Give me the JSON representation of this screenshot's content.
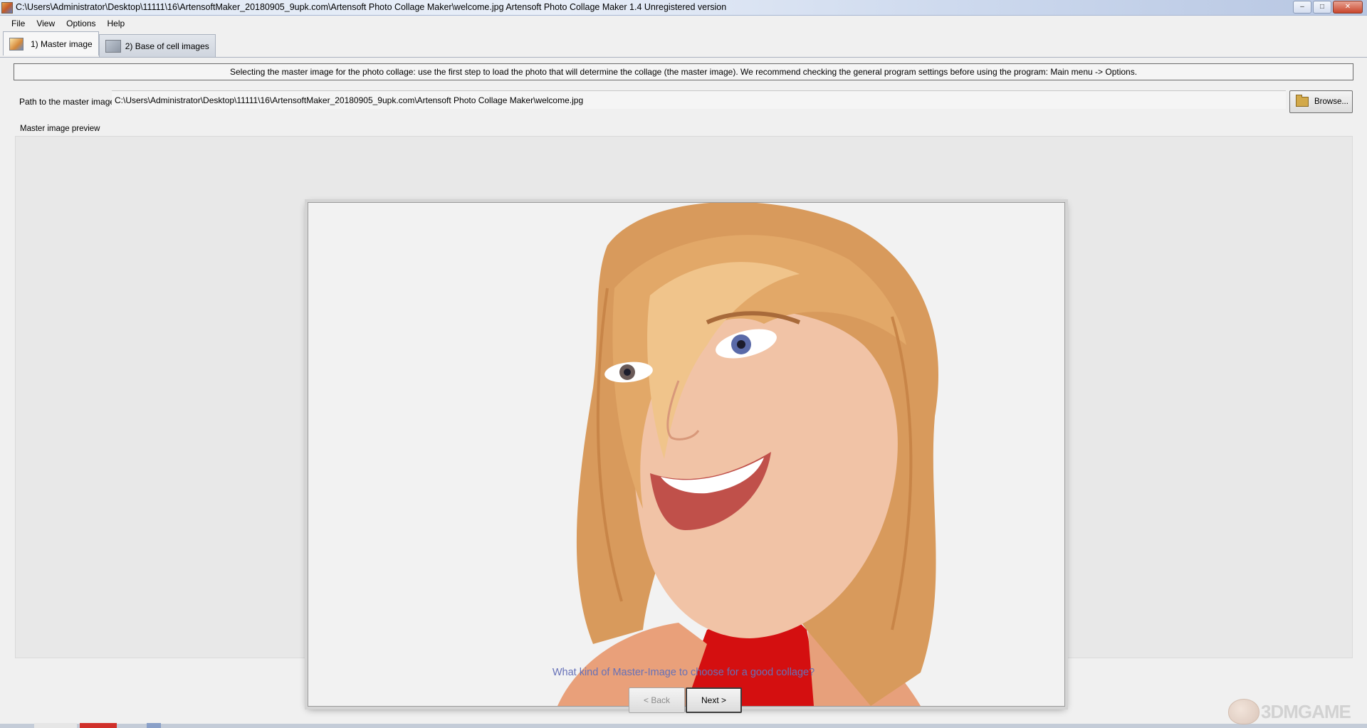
{
  "window": {
    "title": "C:\\Users\\Administrator\\Desktop\\11111\\16\\ArtensoftMaker_20180905_9upk.com\\Artensoft Photo Collage Maker\\welcome.jpg Artensoft Photo Collage Maker 1.4  Unregistered version",
    "controls": {
      "minimize": "–",
      "maximize": "□",
      "close": "✕"
    }
  },
  "menu": {
    "items": [
      "File",
      "View",
      "Options",
      "Help"
    ]
  },
  "tabs": [
    {
      "label": "1) Master image",
      "icon": "master-image-icon"
    },
    {
      "label": "2) Base of cell images",
      "icon": "cell-images-icon"
    }
  ],
  "info": "Selecting the master image for the photo collage: use the first step to load the photo that will determine the collage (the master image). We recommend checking the general program settings before using the program: Main menu -> Options.",
  "path": {
    "label": "Path to the master image:",
    "value": "C:\\Users\\Administrator\\Desktop\\11111\\16\\ArtensoftMaker_20180905_9upk.com\\Artensoft  Photo  Collage  Maker\\welcome.jpg"
  },
  "browse": {
    "label": "Browse...",
    "icon": "folder-icon"
  },
  "preview": {
    "legend": "Master image preview"
  },
  "question": "What kind of Master-Image to choose for a good collage?",
  "buttons": {
    "back": "< Back",
    "next": "Next >"
  },
  "watermark": "3DMGAME",
  "colors": {
    "accent_link": "#6671b8",
    "window_bg": "#f0f0f0",
    "preview_bg": "#e8e8e8"
  }
}
